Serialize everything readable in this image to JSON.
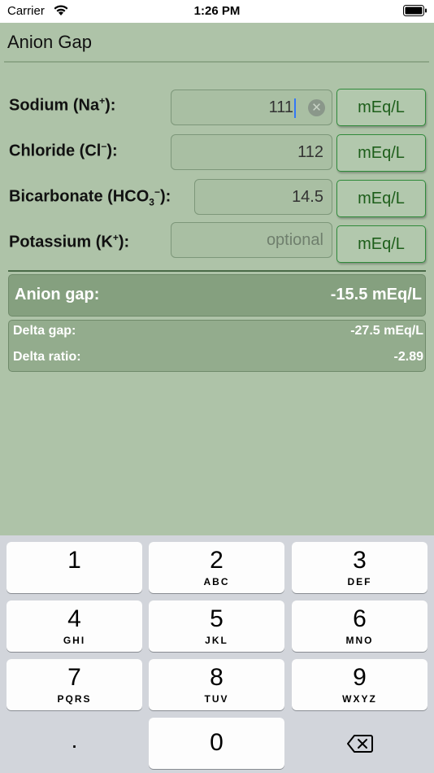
{
  "status_bar": {
    "carrier": "Carrier",
    "time": "1:26 PM"
  },
  "nav": {
    "title": "Anion Gap"
  },
  "inputs": [
    {
      "label_main": "Sodium (Na",
      "label_sup": "+",
      "label_sub": "",
      "label_end": "):",
      "value": "111",
      "placeholder": "",
      "unit": "mEq/L"
    },
    {
      "label_main": "Chloride (Cl",
      "label_sup": "−",
      "label_sub": "",
      "label_end": "):",
      "value": "112",
      "placeholder": "",
      "unit": "mEq/L"
    },
    {
      "label_main": "Bicarbonate (HCO",
      "label_sup": "−",
      "label_sub": "3",
      "label_end": "):",
      "value": "14.5",
      "placeholder": "",
      "unit": "mEq/L"
    },
    {
      "label_main": "Potassium (K",
      "label_sup": "+",
      "label_sub": "",
      "label_end": "):",
      "value": "",
      "placeholder": "optional",
      "unit": "mEq/L"
    }
  ],
  "results": {
    "anion_gap_label": "Anion gap:",
    "anion_gap_value": "-15.5 mEq/L",
    "delta_gap_label": "Delta gap:",
    "delta_gap_value": "-27.5 mEq/L",
    "delta_ratio_label": "Delta ratio:",
    "delta_ratio_value": "-2.89"
  },
  "keyboard": {
    "keys": [
      {
        "digit": "1",
        "letters": ""
      },
      {
        "digit": "2",
        "letters": "ABC"
      },
      {
        "digit": "3",
        "letters": "DEF"
      },
      {
        "digit": "4",
        "letters": "GHI"
      },
      {
        "digit": "5",
        "letters": "JKL"
      },
      {
        "digit": "6",
        "letters": "MNO"
      },
      {
        "digit": "7",
        "letters": "PQRS"
      },
      {
        "digit": "8",
        "letters": "TUV"
      },
      {
        "digit": "9",
        "letters": "WXYZ"
      },
      {
        "digit": "0",
        "letters": ""
      }
    ],
    "decimal": ".",
    "delete_icon": "delete-backward-icon"
  },
  "colors": {
    "background": "#aec3a8",
    "accent_green": "#1d5e1a",
    "result_bg": "#85a07f",
    "caret": "#3478f6"
  }
}
